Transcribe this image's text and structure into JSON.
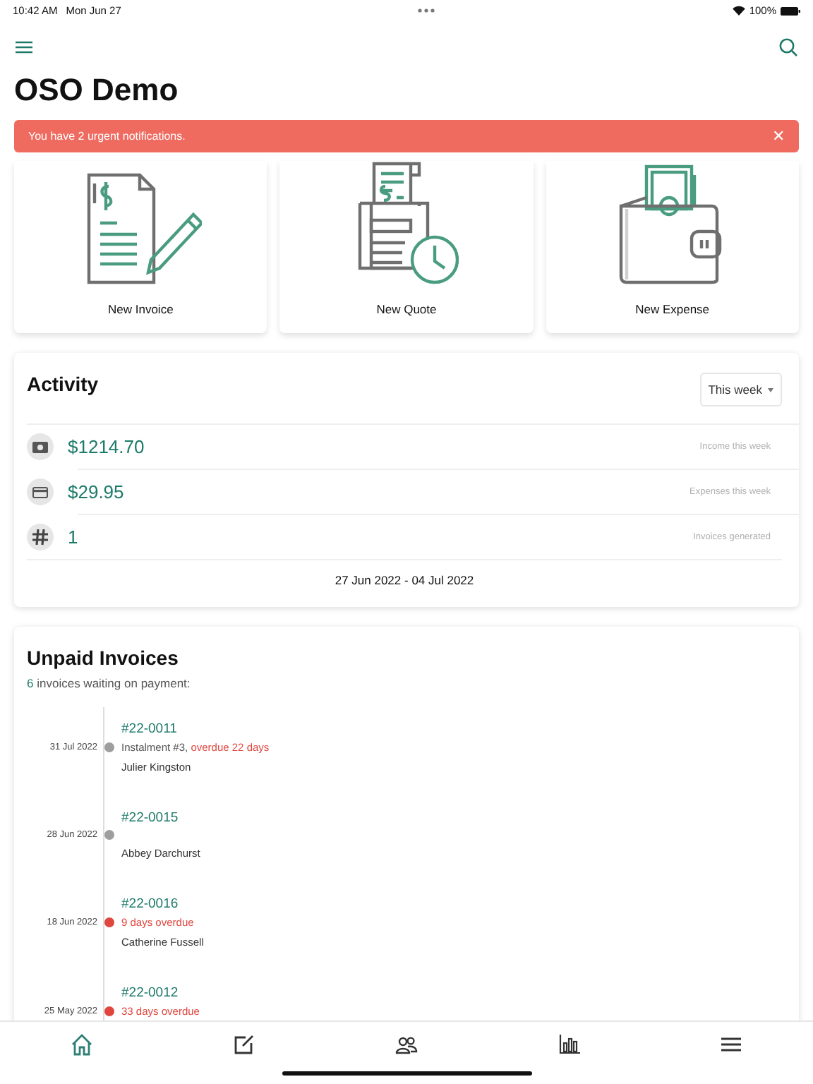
{
  "status_bar": {
    "time": "10:42 AM",
    "date": "Mon Jun 27",
    "battery": "100%"
  },
  "title": "OSO Demo",
  "alert": {
    "message": "You have 2 urgent notifications.",
    "close": "✕"
  },
  "actions": [
    {
      "label": "New Invoice"
    },
    {
      "label": "New Quote"
    },
    {
      "label": "New Expense"
    }
  ],
  "activity": {
    "title": "Activity",
    "period": "This week",
    "rows": [
      {
        "value": "$1214.70",
        "label": "Income this week"
      },
      {
        "value": "$29.95",
        "label": "Expenses this week"
      },
      {
        "value": "1",
        "label": "Invoices generated"
      }
    ],
    "range": "27 Jun 2022 - 04 Jul 2022"
  },
  "unpaid": {
    "title": "Unpaid Invoices",
    "count": "6",
    "summary": "invoices waiting on payment:",
    "invoices": [
      {
        "number": "#22-0011",
        "date": "31 Jul 2022",
        "color": "#9e9e9e",
        "note": "Instalment #3, ",
        "overdue": "overdue 22 days",
        "customer": "Julier Kingston"
      },
      {
        "number": "#22-0015",
        "date": "28 Jun 2022",
        "color": "#9e9e9e",
        "customer": "Abbey Darchurst"
      },
      {
        "number": "#22-0016",
        "date": "18 Jun 2022",
        "color": "#e0463e",
        "overdue": "9 days overdue",
        "customer": "Catherine Fussell"
      },
      {
        "number": "#22-0012",
        "date": "25 May 2022",
        "color": "#e0463e",
        "overdue": "33 days overdue"
      }
    ]
  },
  "tabs": [
    {
      "selected": true
    },
    {
      "selected": false
    },
    {
      "selected": false
    },
    {
      "selected": false
    },
    {
      "selected": false
    }
  ]
}
